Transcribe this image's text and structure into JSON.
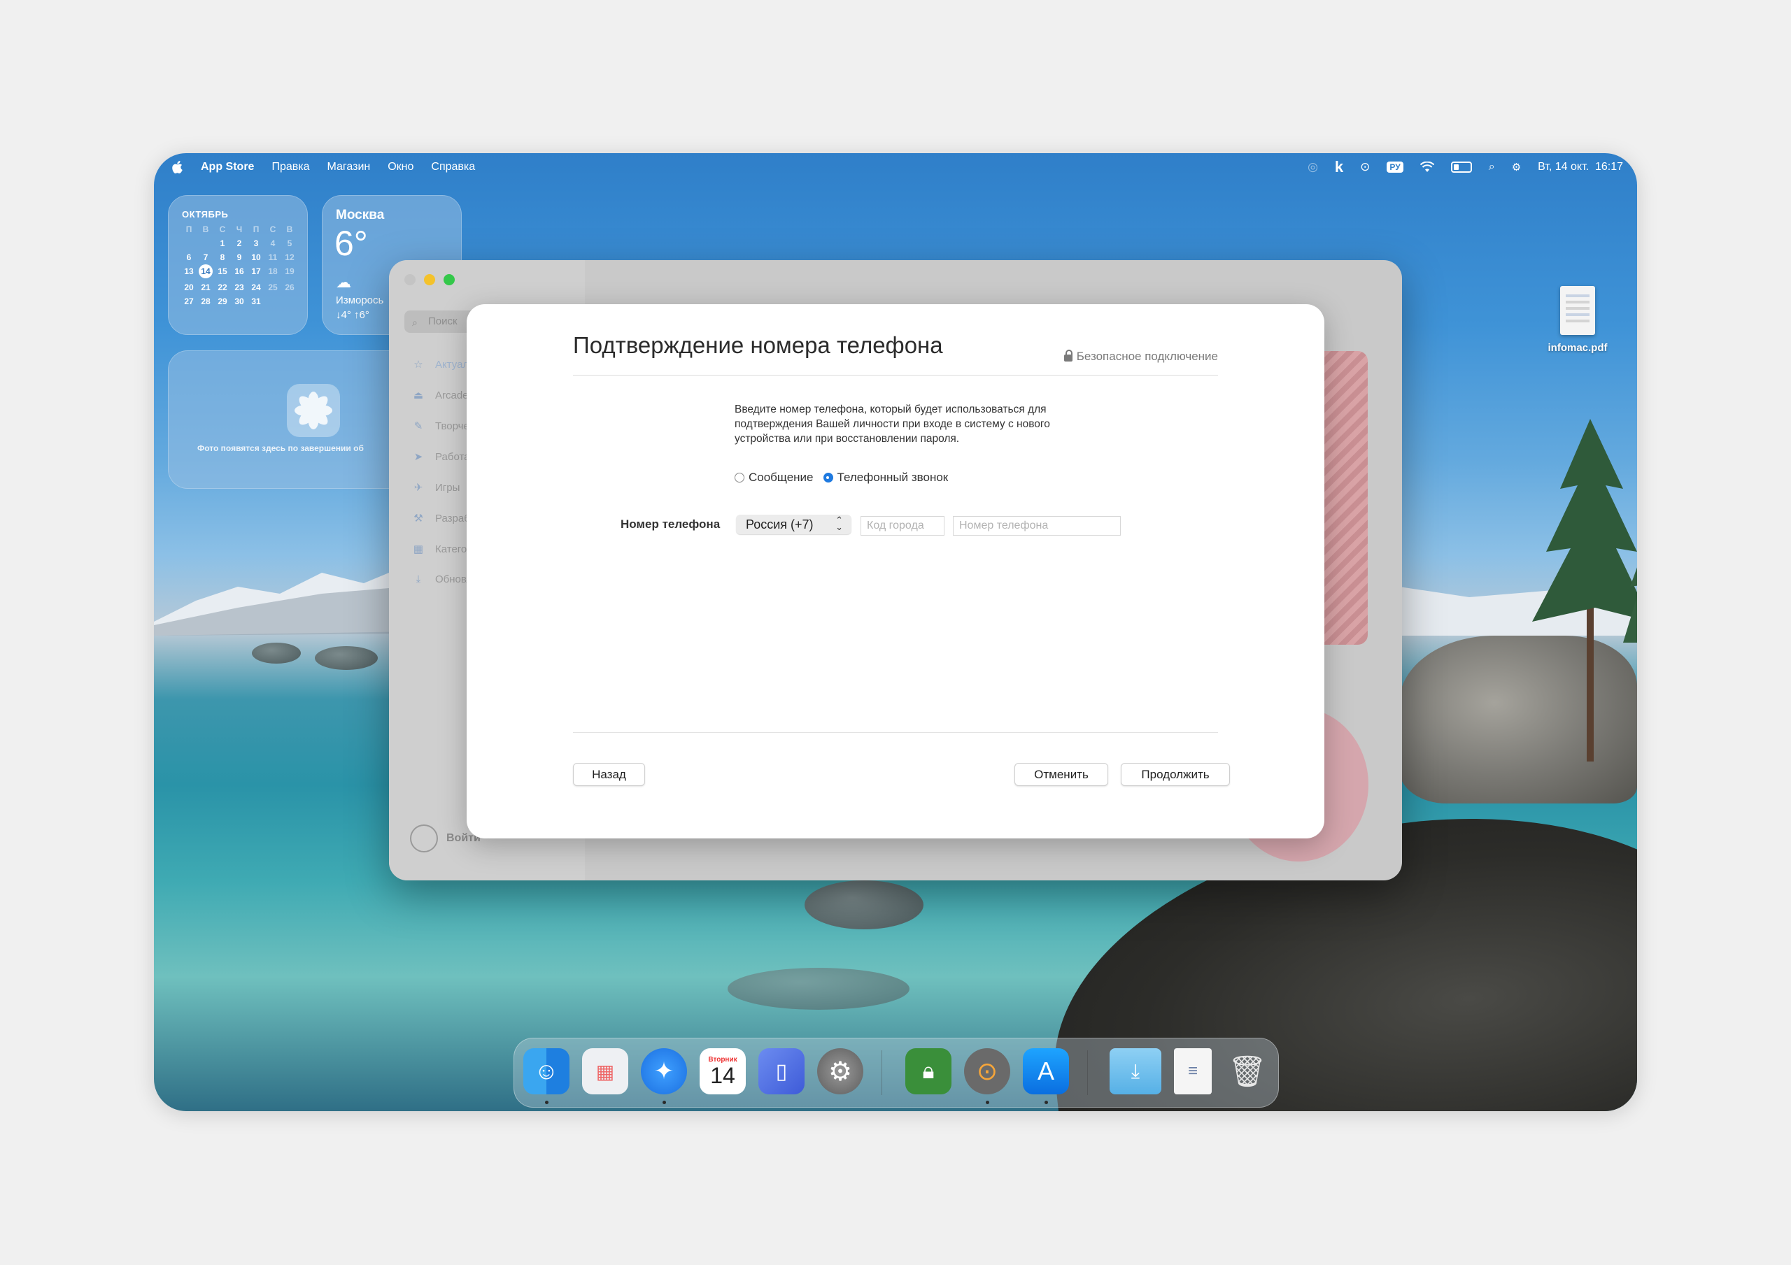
{
  "menubar": {
    "app_name": "App Store",
    "items": [
      "Правка",
      "Магазин",
      "Окно",
      "Справка"
    ],
    "keyboard_layout": "РУ",
    "clock": "Вт, 14 окт.  16:17"
  },
  "calendar_widget": {
    "month": "ОКТЯБРЬ",
    "weekdays": [
      "П",
      "В",
      "С",
      "Ч",
      "П",
      "С",
      "В"
    ],
    "days": [
      "",
      "",
      "1",
      "2",
      "3",
      "4",
      "5",
      "6",
      "7",
      "8",
      "9",
      "10",
      "11",
      "12",
      "13",
      "14",
      "15",
      "16",
      "17",
      "18",
      "19",
      "20",
      "21",
      "22",
      "23",
      "24",
      "25",
      "26",
      "27",
      "28",
      "29",
      "30",
      "31"
    ],
    "today": "14"
  },
  "weather_widget": {
    "city": "Москва",
    "temperature": "6°",
    "condition": "Изморось",
    "range": "↓4° ↑6°"
  },
  "photos_widget": {
    "text": "Фото появятся здесь по завершении об"
  },
  "appstore_window": {
    "search_placeholder": "Поиск",
    "sidebar_items": [
      "Актуальное",
      "Arcade",
      "Творчество",
      "Работа",
      "Игры",
      "Разработка",
      "Категории",
      "Обновления"
    ],
    "sign_in": "Войти"
  },
  "dialog": {
    "title": "Подтверждение номера телефона",
    "secure": "Безопасное подключение",
    "description": "Введите номер телефона, который будет использоваться для подтверждения Вашей личности при входе в систему с нового устройства или при восстановлении пароля.",
    "option_message": "Сообщение",
    "option_call": "Телефонный звонок",
    "selected_option": "call",
    "phone_label": "Номер телефона",
    "country": "Россия (+7)",
    "area_code_placeholder": "Код города",
    "phone_placeholder": "Номер телефона",
    "back_button": "Назад",
    "cancel_button": "Отменить",
    "continue_button": "Продолжить"
  },
  "desktop_file": {
    "name": "infomac.pdf"
  },
  "calendar_dock_icon": {
    "weekday": "Вторник",
    "day": "14"
  },
  "colors": {
    "accent": "#1f7ae0",
    "sky": "#3f93d7"
  }
}
